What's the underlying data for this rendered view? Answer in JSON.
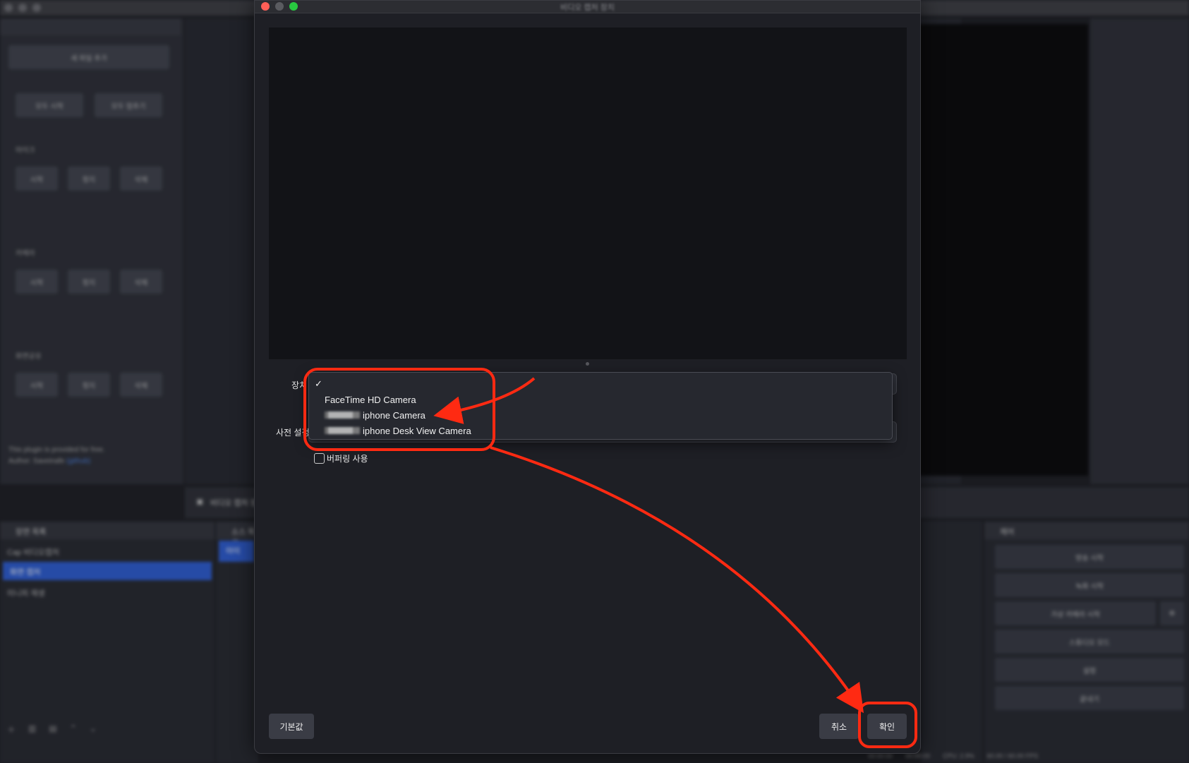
{
  "background": {
    "left_buttons": [
      "새 파일 추가",
      "모두 시작",
      "모두 멈추기"
    ],
    "section_labels": [
      "마이크",
      "카메라",
      "화면공유"
    ],
    "section_buttons": [
      "시작",
      "정지",
      "삭제"
    ],
    "plugin_note": "This plugin is provided for free.",
    "plugin_author": "Author: Saveinafe",
    "plugin_link": "(github)",
    "tool_bar_label": "비디오 캡처 장치",
    "scenes_header": "장면 목록",
    "scenes": [
      "Cap 비디오캡처",
      "화면 캡처",
      "미니피 재생"
    ],
    "sources_header": "소스 목록",
    "sources_item": "아이",
    "controls_header": "제어",
    "controls": [
      "방송 시작",
      "녹화 시작",
      "가상 카메라 시작",
      "스튜디오 모드",
      "설정",
      "끝내기"
    ],
    "status": [
      "00:00:00",
      "00:00:00",
      "CPU: 2.9%",
      "60.00 / 60.00 FPS"
    ]
  },
  "dialog": {
    "title": "비디오 캡처 장치",
    "device_label": "장치",
    "preset_label": "사전 설정",
    "dropdown_items": [
      {
        "label": "",
        "checked": true
      },
      {
        "label": "FaceTime HD Camera",
        "checked": false
      },
      {
        "label": "iphone Camera",
        "checked": false,
        "redacted_prefix": true
      },
      {
        "label": "iphone Desk View Camera",
        "checked": false,
        "redacted_prefix": true
      }
    ],
    "check_mark": "✓",
    "buffering_label": "버퍼링 사용",
    "buffering_checked": false,
    "defaults_button": "기본값",
    "cancel_button": "취소",
    "ok_button": "확인"
  },
  "colors": {
    "annotation": "#ff2a12",
    "selection_blue": "#2a5bd3",
    "dialog_bg": "#1e1f25"
  }
}
